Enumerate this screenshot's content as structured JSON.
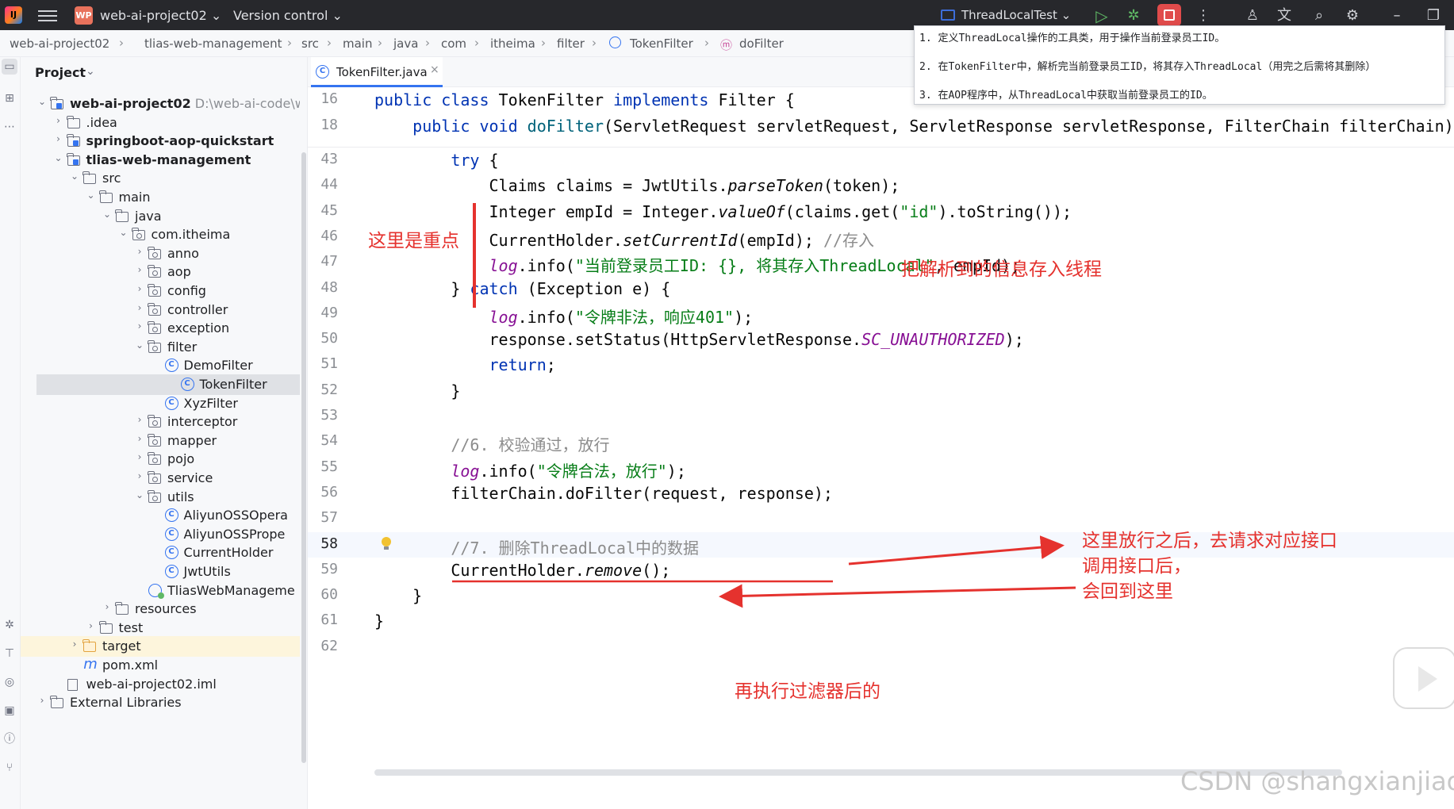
{
  "titlebar": {
    "logo": "IJ",
    "project_badge": "WP",
    "project_name": "web-ai-project02",
    "version_control": "Version control",
    "run_config": "ThreadLocalTest",
    "icons": [
      "menu-icon",
      "run-icon",
      "debug-icon",
      "stop-icon",
      "more-icon",
      "account-icon",
      "translate-icon",
      "search-icon",
      "settings-icon",
      "minimize-icon",
      "restore-icon"
    ]
  },
  "breadcrumbs": [
    "web-ai-project02",
    "tlias-web-management",
    "src",
    "main",
    "java",
    "com",
    "itheima",
    "filter",
    "TokenFilter",
    "doFilter"
  ],
  "note": {
    "lines": [
      "1.  定义ThreadLocal操作的工具类，用于操作当前登录员工ID。",
      "2.  在TokenFilter中，解析完当前登录员工ID，将其存入ThreadLocal（用完之后需将其删除）",
      "3.  在AOP程序中，从ThreadLocal中获取当前登录员工的ID。"
    ]
  },
  "project_panel": {
    "title": "Project",
    "tree": [
      {
        "label": "web-ai-project02",
        "hint": "D:\\web-ai-code\\we",
        "depth": 0,
        "arrow": "down",
        "icon": "module",
        "bold": true
      },
      {
        "label": ".idea",
        "depth": 1,
        "arrow": "right",
        "icon": "folder"
      },
      {
        "label": "springboot-aop-quickstart",
        "depth": 1,
        "arrow": "right",
        "icon": "module",
        "bold": true
      },
      {
        "label": "tlias-web-management",
        "depth": 1,
        "arrow": "down",
        "icon": "module",
        "bold": true
      },
      {
        "label": "src",
        "depth": 2,
        "arrow": "down",
        "icon": "folder"
      },
      {
        "label": "main",
        "depth": 3,
        "arrow": "down",
        "icon": "folder"
      },
      {
        "label": "java",
        "depth": 4,
        "arrow": "down",
        "icon": "folder"
      },
      {
        "label": "com.itheima",
        "depth": 5,
        "arrow": "down",
        "icon": "package"
      },
      {
        "label": "anno",
        "depth": 6,
        "arrow": "right",
        "icon": "package"
      },
      {
        "label": "aop",
        "depth": 6,
        "arrow": "right",
        "icon": "package"
      },
      {
        "label": "config",
        "depth": 6,
        "arrow": "right",
        "icon": "package"
      },
      {
        "label": "controller",
        "depth": 6,
        "arrow": "right",
        "icon": "package"
      },
      {
        "label": "exception",
        "depth": 6,
        "arrow": "right",
        "icon": "package"
      },
      {
        "label": "filter",
        "depth": 6,
        "arrow": "down",
        "icon": "package"
      },
      {
        "label": "DemoFilter",
        "depth": 7,
        "arrow": "",
        "icon": "class"
      },
      {
        "label": "TokenFilter",
        "depth": 7,
        "arrow": "",
        "icon": "class",
        "selected": true
      },
      {
        "label": "XyzFilter",
        "depth": 7,
        "arrow": "",
        "icon": "class"
      },
      {
        "label": "interceptor",
        "depth": 6,
        "arrow": "right",
        "icon": "package"
      },
      {
        "label": "mapper",
        "depth": 6,
        "arrow": "right",
        "icon": "package"
      },
      {
        "label": "pojo",
        "depth": 6,
        "arrow": "right",
        "icon": "package"
      },
      {
        "label": "service",
        "depth": 6,
        "arrow": "right",
        "icon": "package"
      },
      {
        "label": "utils",
        "depth": 6,
        "arrow": "down",
        "icon": "package"
      },
      {
        "label": "AliyunOSSOpera",
        "depth": 7,
        "arrow": "",
        "icon": "class"
      },
      {
        "label": "AliyunOSSPrope",
        "depth": 7,
        "arrow": "",
        "icon": "class"
      },
      {
        "label": "CurrentHolder",
        "depth": 7,
        "arrow": "",
        "icon": "class"
      },
      {
        "label": "JwtUtils",
        "depth": 7,
        "arrow": "",
        "icon": "class"
      },
      {
        "label": "TliasWebManageme",
        "depth": 6,
        "arrow": "",
        "icon": "spring"
      },
      {
        "label": "resources",
        "depth": 4,
        "arrow": "right",
        "icon": "folder"
      },
      {
        "label": "test",
        "depth": 3,
        "arrow": "right",
        "icon": "folder"
      },
      {
        "label": "target",
        "depth": 2,
        "arrow": "right",
        "icon": "target",
        "highlight": true
      },
      {
        "label": "pom.xml",
        "depth": 2,
        "arrow": "",
        "icon": "maven"
      },
      {
        "label": "web-ai-project02.iml",
        "depth": 1,
        "arrow": "",
        "icon": "iml"
      },
      {
        "label": "External Libraries",
        "depth": 0,
        "arrow": "right",
        "icon": "library"
      }
    ]
  },
  "editor": {
    "tab_label": "TokenFilter.java",
    "tab_close": "×",
    "sticky_lines": [
      {
        "n": "16",
        "html": "<span class=\"kw\">public class</span> TokenFilter <span class=\"kw\">implements</span> Filter {"
      },
      {
        "n": "18",
        "html": "    <span class=\"kw\">public void</span> <span class=\"fn\">doFilter</span>(ServletRequest servletRequest, ServletResponse servletResponse, FilterChain filterChain)"
      }
    ],
    "lines": [
      {
        "n": "43",
        "html": "        <span class=\"kw\">try</span> {"
      },
      {
        "n": "44",
        "html": "            Claims claims = JwtUtils.<span class=\"it\">parseToken</span>(token);"
      },
      {
        "n": "45",
        "html": "            Integer empId = Integer.<span class=\"it\">valueOf</span>(claims.get(<span class=\"str\">\"id\"</span>).toString());"
      },
      {
        "n": "46",
        "html": "            CurrentHolder.<span class=\"it\">setCurrentId</span>(empId); <span class=\"cm\">//<span class=\"cjk\">存入</span></span>"
      },
      {
        "n": "47",
        "html": "            <span class=\"fld\">log</span>.info(<span class=\"str\">\"<span class=\"cjk\">当前登录员工</span>ID: {}, <span class=\"cjk\">将其存入</span>ThreadLocal\"</span>, empId);"
      },
      {
        "n": "48",
        "html": "        } <span class=\"kw\">catch</span> (Exception e) {"
      },
      {
        "n": "49",
        "html": "            <span class=\"fld\">log</span>.info(<span class=\"str\">\"<span class=\"cjk\">令牌非法，响应</span>401\"</span>);"
      },
      {
        "n": "50",
        "html": "            response.setStatus(HttpServletResponse.<span class=\"fld\">SC_UNAUTHORIZED</span>);"
      },
      {
        "n": "51",
        "html": "            <span class=\"kw\">return</span>;"
      },
      {
        "n": "52",
        "html": "        }"
      },
      {
        "n": "53",
        "html": ""
      },
      {
        "n": "54",
        "html": "        <span class=\"cm\">//6. <span class=\"cjk\">校验通过，放行</span></span>"
      },
      {
        "n": "55",
        "html": "        <span class=\"fld\">log</span>.info(<span class=\"str\">\"<span class=\"cjk\">令牌合法，放行</span>\"</span>);"
      },
      {
        "n": "56",
        "html": "        filterChain.doFilter(request, response);"
      },
      {
        "n": "57",
        "html": ""
      },
      {
        "n": "58",
        "html": "        <span class=\"cm\">//7. <span class=\"cjk\">删除</span>ThreadLocal<span class=\"cjk\">中的数据</span></span>"
      },
      {
        "n": "59",
        "html": "        CurrentHolder.<span class=\"it\">remove</span>();"
      },
      {
        "n": "60",
        "html": "    }"
      },
      {
        "n": "61",
        "html": "}"
      },
      {
        "n": "62",
        "html": ""
      }
    ],
    "current_line": "58"
  },
  "annotations": {
    "key_point": "这里是重点",
    "store_thread": "把解析到的信息存入线程",
    "release_1": "这里放行之后，去请求对应接口",
    "release_2": "调用接口后，",
    "release_3": "会回到这里",
    "after_filter": "再执行过滤器后的"
  },
  "watermark": "CSDN @shangxianjiao",
  "colors": {
    "annotation": "#e5322e",
    "keyword": "#0033b3",
    "string": "#067d17",
    "comment": "#8c8c8c",
    "accent": "#3574f0"
  }
}
